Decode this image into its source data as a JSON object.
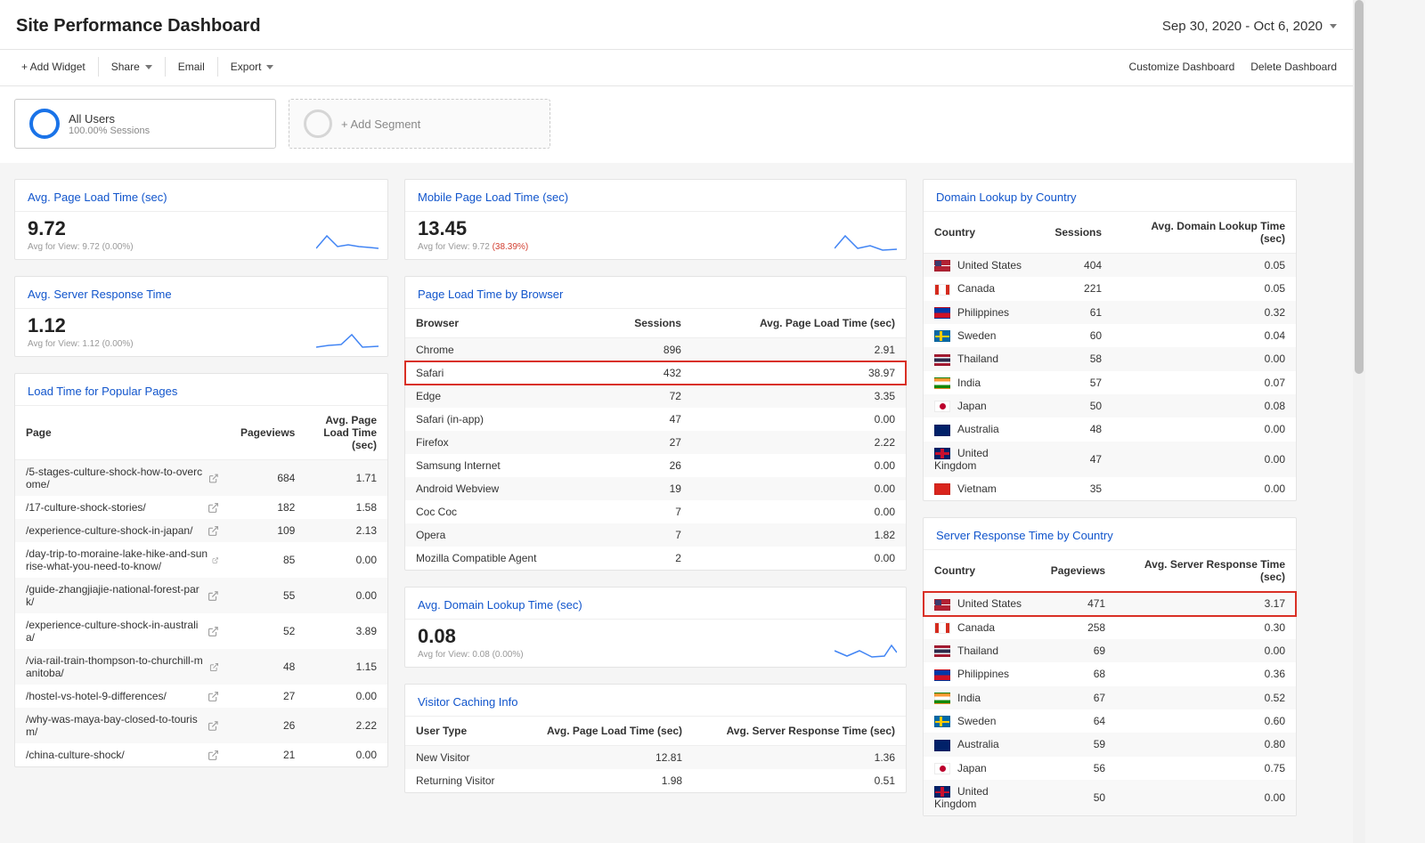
{
  "header": {
    "title": "Site Performance Dashboard",
    "date_range": "Sep 30, 2020 - Oct 6, 2020"
  },
  "toolbar": {
    "add_widget": "+ Add Widget",
    "share": "Share",
    "email": "Email",
    "export": "Export",
    "customize": "Customize Dashboard",
    "delete": "Delete Dashboard"
  },
  "segments": {
    "primary": {
      "title": "All Users",
      "subtitle": "100.00% Sessions"
    },
    "add": "+ Add Segment"
  },
  "cards": {
    "avg_load": {
      "title": "Avg. Page Load Time (sec)",
      "value": "9.72",
      "sub_prefix": "Avg for View: ",
      "sub_val": "9.72 (0.00%)"
    },
    "avg_srv": {
      "title": "Avg. Server Response Time",
      "value": "1.12",
      "sub_prefix": "Avg for View: ",
      "sub_val": "1.12 (0.00%)"
    },
    "mobile_load": {
      "title": "Mobile Page Load Time (sec)",
      "value": "13.45",
      "sub_prefix": "Avg for View: 9.72 ",
      "sub_pct": "(38.39%)"
    },
    "avg_dns": {
      "title": "Avg. Domain Lookup Time (sec)",
      "value": "0.08",
      "sub_prefix": "Avg for View: ",
      "sub_val": "0.08 (0.00%)"
    },
    "popular": {
      "title": "Load Time for Popular Pages",
      "cols": {
        "page": "Page",
        "pv": "Pageviews",
        "load": "Avg. Page Load Time (sec)"
      },
      "rows": [
        {
          "page": "/5-stages-culture-shock-how-to-overcome/",
          "pv": "684",
          "load": "1.71"
        },
        {
          "page": "/17-culture-shock-stories/",
          "pv": "182",
          "load": "1.58"
        },
        {
          "page": "/experience-culture-shock-in-japan/",
          "pv": "109",
          "load": "2.13"
        },
        {
          "page": "/day-trip-to-moraine-lake-hike-and-sunrise-what-you-need-to-know/",
          "pv": "85",
          "load": "0.00"
        },
        {
          "page": "/guide-zhangjiajie-national-forest-park/",
          "pv": "55",
          "load": "0.00"
        },
        {
          "page": "/experience-culture-shock-in-australia/",
          "pv": "52",
          "load": "3.89"
        },
        {
          "page": "/via-rail-train-thompson-to-churchill-manitoba/",
          "pv": "48",
          "load": "1.15"
        },
        {
          "page": "/hostel-vs-hotel-9-differences/",
          "pv": "27",
          "load": "0.00"
        },
        {
          "page": "/why-was-maya-bay-closed-to-tourism/",
          "pv": "26",
          "load": "2.22"
        },
        {
          "page": "/china-culture-shock/",
          "pv": "21",
          "load": "0.00"
        }
      ]
    },
    "by_browser": {
      "title": "Page Load Time by Browser",
      "cols": {
        "browser": "Browser",
        "sess": "Sessions",
        "load": "Avg. Page Load Time (sec)"
      },
      "rows": [
        {
          "browser": "Chrome",
          "sess": "896",
          "load": "2.91"
        },
        {
          "browser": "Safari",
          "sess": "432",
          "load": "38.97",
          "hl": true
        },
        {
          "browser": "Edge",
          "sess": "72",
          "load": "3.35"
        },
        {
          "browser": "Safari (in-app)",
          "sess": "47",
          "load": "0.00"
        },
        {
          "browser": "Firefox",
          "sess": "27",
          "load": "2.22"
        },
        {
          "browser": "Samsung Internet",
          "sess": "26",
          "load": "0.00"
        },
        {
          "browser": "Android Webview",
          "sess": "19",
          "load": "0.00"
        },
        {
          "browser": "Coc Coc",
          "sess": "7",
          "load": "0.00"
        },
        {
          "browser": "Opera",
          "sess": "7",
          "load": "1.82"
        },
        {
          "browser": "Mozilla Compatible Agent",
          "sess": "2",
          "load": "0.00"
        }
      ]
    },
    "caching": {
      "title": "Visitor Caching Info",
      "cols": {
        "user": "User Type",
        "load": "Avg. Page Load Time (sec)",
        "srv": "Avg. Server Response Time (sec)"
      },
      "rows": [
        {
          "user": "New Visitor",
          "load": "12.81",
          "srv": "1.36"
        },
        {
          "user": "Returning Visitor",
          "load": "1.98",
          "srv": "0.51"
        }
      ]
    },
    "dns_country": {
      "title": "Domain Lookup by Country",
      "cols": {
        "country": "Country",
        "sess": "Sessions",
        "dns": "Avg. Domain Lookup Time (sec)"
      },
      "rows": [
        {
          "flag": "us",
          "country": "United States",
          "sess": "404",
          "dns": "0.05"
        },
        {
          "flag": "ca",
          "country": "Canada",
          "sess": "221",
          "dns": "0.05"
        },
        {
          "flag": "ph",
          "country": "Philippines",
          "sess": "61",
          "dns": "0.32"
        },
        {
          "flag": "se",
          "country": "Sweden",
          "sess": "60",
          "dns": "0.04"
        },
        {
          "flag": "th",
          "country": "Thailand",
          "sess": "58",
          "dns": "0.00"
        },
        {
          "flag": "in",
          "country": "India",
          "sess": "57",
          "dns": "0.07"
        },
        {
          "flag": "jp",
          "country": "Japan",
          "sess": "50",
          "dns": "0.08"
        },
        {
          "flag": "au",
          "country": "Australia",
          "sess": "48",
          "dns": "0.00"
        },
        {
          "flag": "gb",
          "country": "United Kingdom",
          "sess": "47",
          "dns": "0.00"
        },
        {
          "flag": "vn",
          "country": "Vietnam",
          "sess": "35",
          "dns": "0.00"
        }
      ]
    },
    "srv_country": {
      "title": "Server Response Time by Country",
      "cols": {
        "country": "Country",
        "pv": "Pageviews",
        "srv": "Avg. Server Response Time (sec)"
      },
      "rows": [
        {
          "flag": "us",
          "country": "United States",
          "pv": "471",
          "srv": "3.17",
          "hl": true
        },
        {
          "flag": "ca",
          "country": "Canada",
          "pv": "258",
          "srv": "0.30"
        },
        {
          "flag": "th",
          "country": "Thailand",
          "pv": "69",
          "srv": "0.00"
        },
        {
          "flag": "ph",
          "country": "Philippines",
          "pv": "68",
          "srv": "0.36"
        },
        {
          "flag": "in",
          "country": "India",
          "pv": "67",
          "srv": "0.52"
        },
        {
          "flag": "se",
          "country": "Sweden",
          "pv": "64",
          "srv": "0.60"
        },
        {
          "flag": "au",
          "country": "Australia",
          "pv": "59",
          "srv": "0.80"
        },
        {
          "flag": "jp",
          "country": "Japan",
          "pv": "56",
          "srv": "0.75"
        },
        {
          "flag": "gb",
          "country": "United Kingdom",
          "pv": "50",
          "srv": "0.00"
        }
      ]
    }
  }
}
